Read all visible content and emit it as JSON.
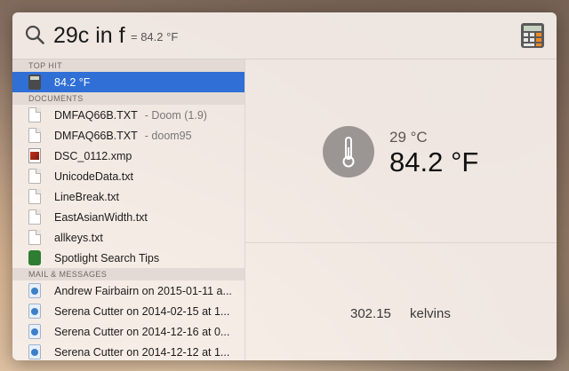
{
  "search": {
    "query": "29c in f",
    "inline_result": "= 84.2 °F"
  },
  "sections": [
    {
      "header": "TOP HIT",
      "items": [
        {
          "label": "84.2 °F",
          "sub": "",
          "icon": "calculator-icon",
          "selected": true
        }
      ]
    },
    {
      "header": "DOCUMENTS",
      "items": [
        {
          "label": "DMFAQ66B.TXT",
          "sub": "- Doom (1.9)",
          "icon": "document-icon"
        },
        {
          "label": "DMFAQ66B.TXT",
          "sub": "- doom95",
          "icon": "document-icon"
        },
        {
          "label": "DSC_0112.xmp",
          "sub": "",
          "icon": "image-file-icon"
        },
        {
          "label": "UnicodeData.txt",
          "sub": "",
          "icon": "document-icon"
        },
        {
          "label": "LineBreak.txt",
          "sub": "",
          "icon": "document-icon"
        },
        {
          "label": "EastAsianWidth.txt",
          "sub": "",
          "icon": "document-icon"
        },
        {
          "label": "allkeys.txt",
          "sub": "",
          "icon": "document-icon"
        },
        {
          "label": "Spotlight Search Tips",
          "sub": "",
          "icon": "tips-book-icon"
        }
      ]
    },
    {
      "header": "MAIL & MESSAGES",
      "items": [
        {
          "label": "Andrew Fairbairn on 2015-01-11 a...",
          "sub": "",
          "icon": "mail-message-icon"
        },
        {
          "label": "Serena Cutter on 2014-02-15 at 1...",
          "sub": "",
          "icon": "mail-message-icon"
        },
        {
          "label": "Serena Cutter on 2014-12-16 at 0...",
          "sub": "",
          "icon": "mail-message-icon"
        },
        {
          "label": "Serena Cutter on 2014-12-12 at 1...",
          "sub": "",
          "icon": "mail-message-icon"
        }
      ]
    }
  ],
  "preview": {
    "celsius": "29 °C",
    "fahrenheit": "84.2 °F",
    "kelvin_value": "302.15",
    "kelvin_unit": "kelvins"
  },
  "colors": {
    "selection": "#2f6fd6"
  }
}
